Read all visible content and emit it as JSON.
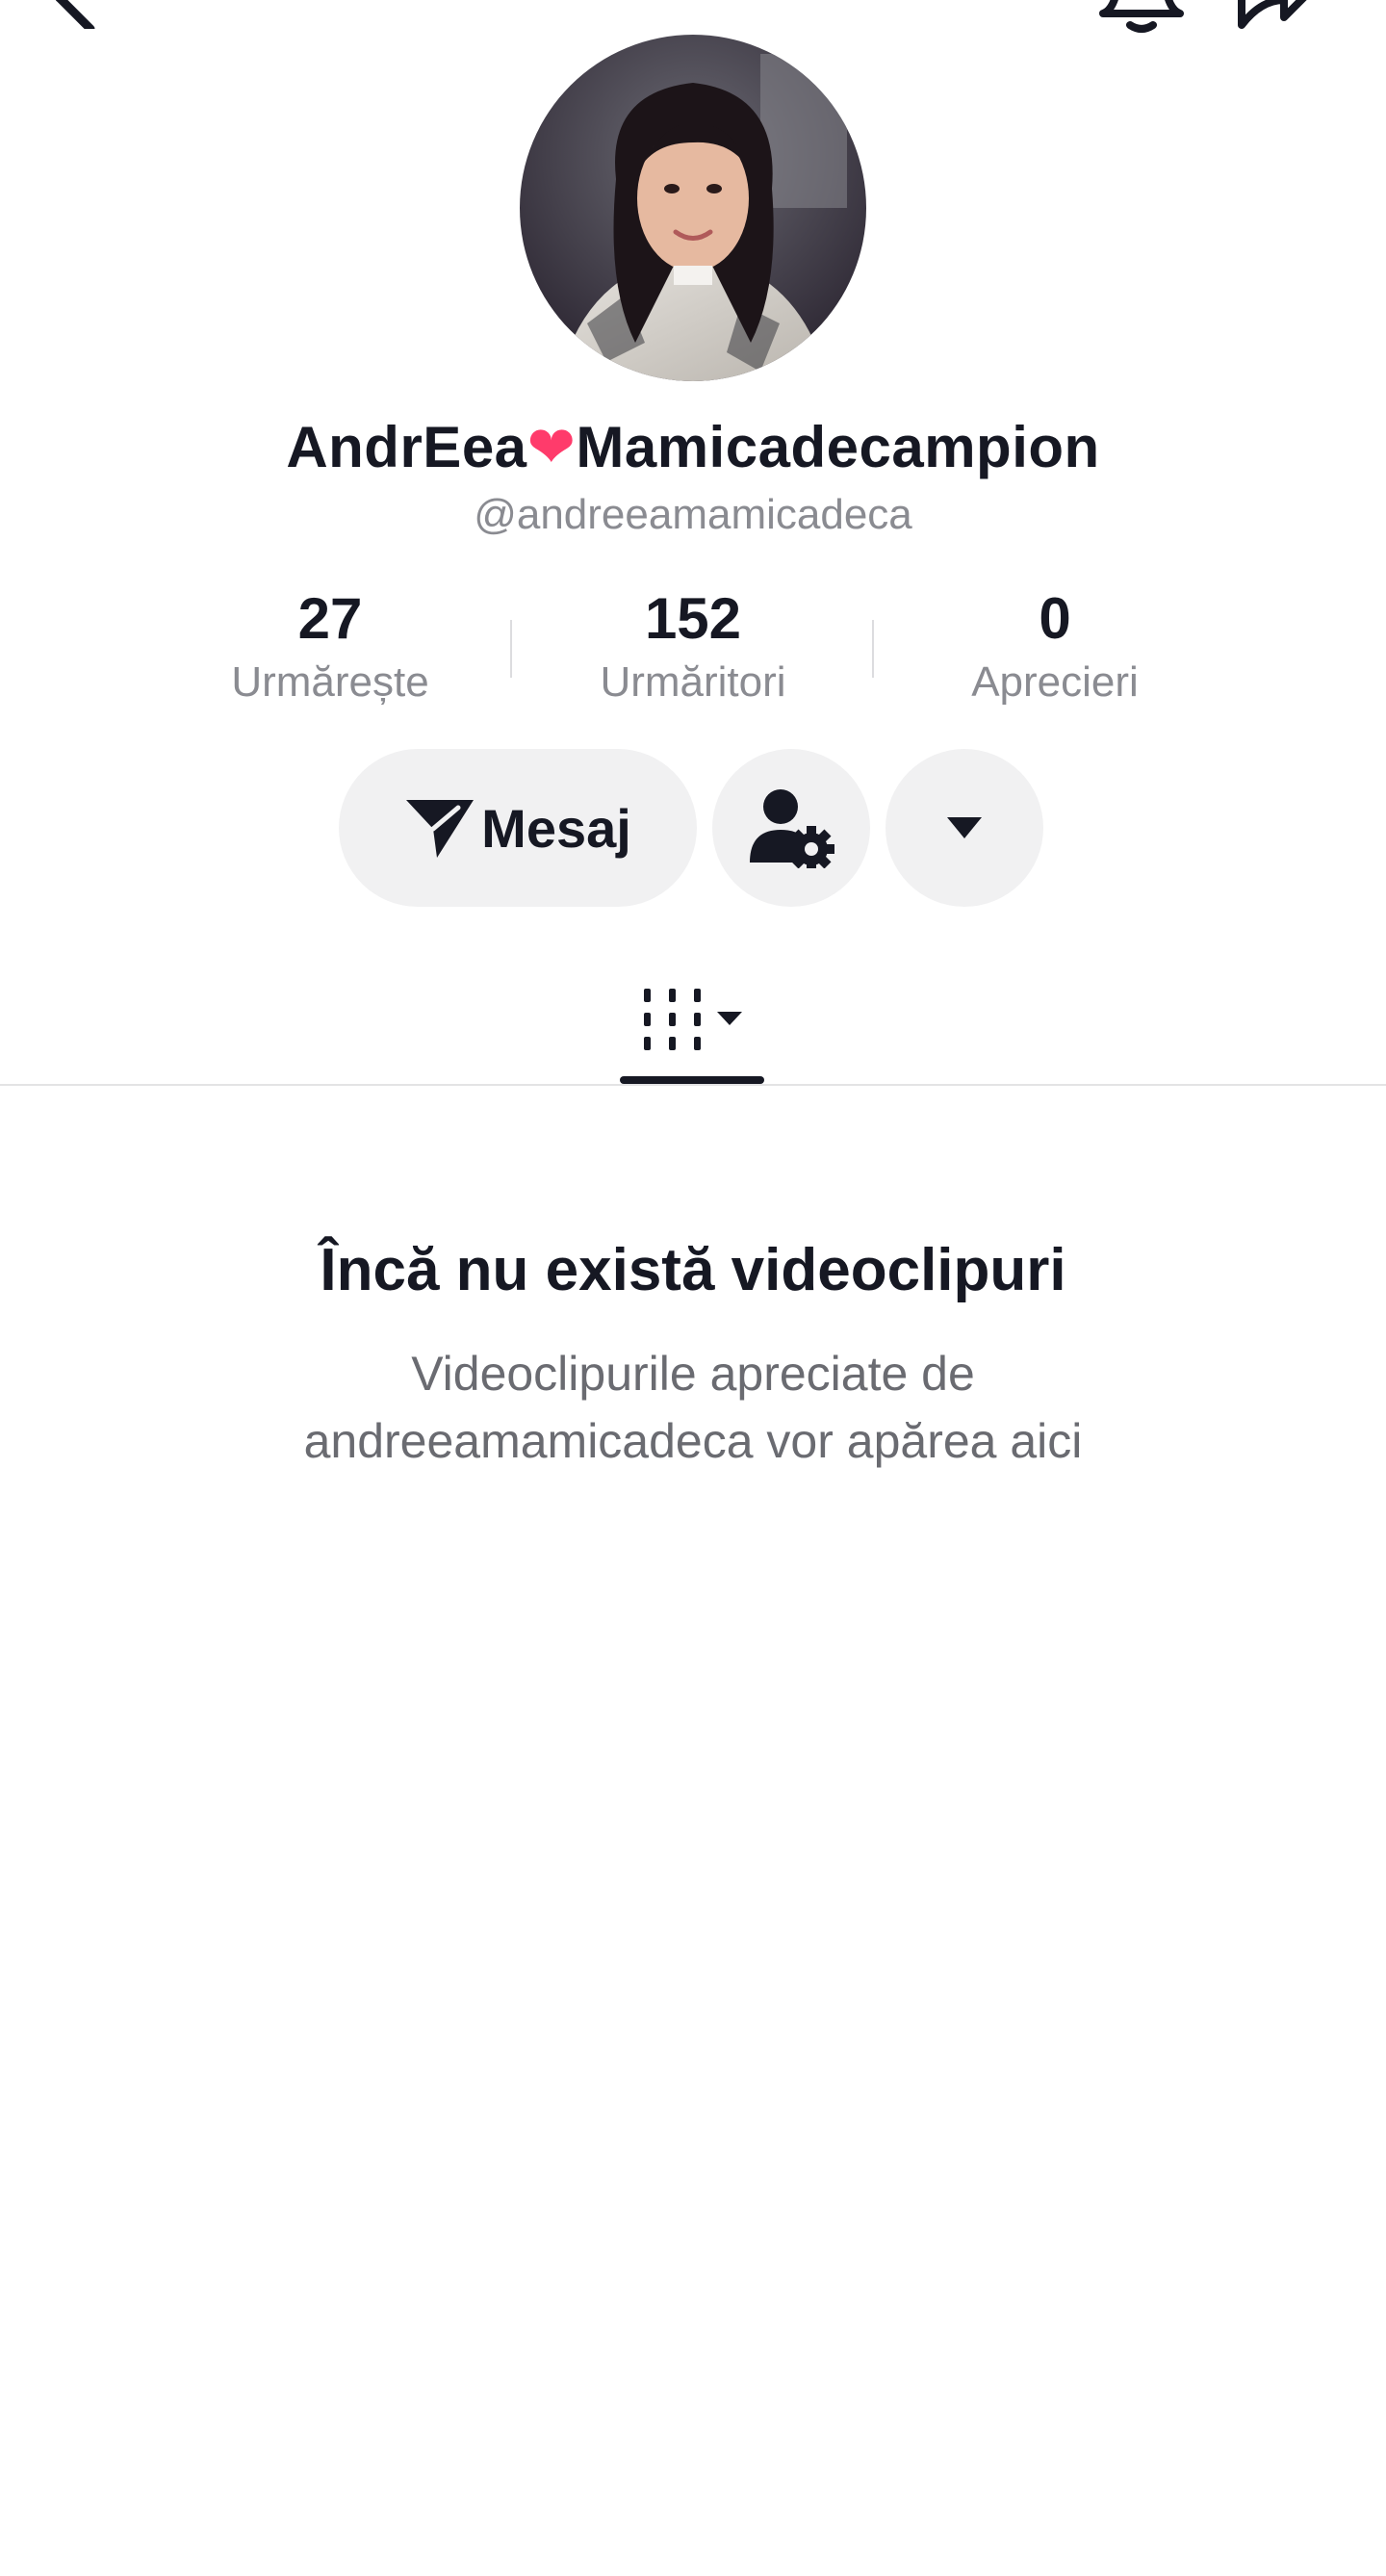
{
  "header": {
    "back_icon": "chevron-left-icon",
    "notification_icon": "bell-icon",
    "share_icon": "share-arrow-icon"
  },
  "profile": {
    "name_part1": "AndrEea",
    "heart": "❤",
    "name_part2": "Mamicadecampion",
    "username": "@andreeamamicadeca"
  },
  "stats": {
    "following_count": "27",
    "following_label": "Urmărește",
    "followers_count": "152",
    "followers_label": "Urmăritori",
    "likes_count": "0",
    "likes_label": "Aprecieri"
  },
  "actions": {
    "message_label": "Mesaj",
    "add_friend_icon": "user-settings-icon",
    "more_icon": "caret-down-icon"
  },
  "tabs": {
    "active_tab_icon": "grid-filter-icon"
  },
  "empty_state": {
    "title": "Încă nu există videoclipuri",
    "description": "Videoclipurile apreciate de andreeamamicadeca vor apărea aici"
  },
  "colors": {
    "accent_heart": "#ff3b6b",
    "button_bg": "#f1f1f2",
    "text_primary": "#161823",
    "text_secondary": "#8a8b91"
  }
}
